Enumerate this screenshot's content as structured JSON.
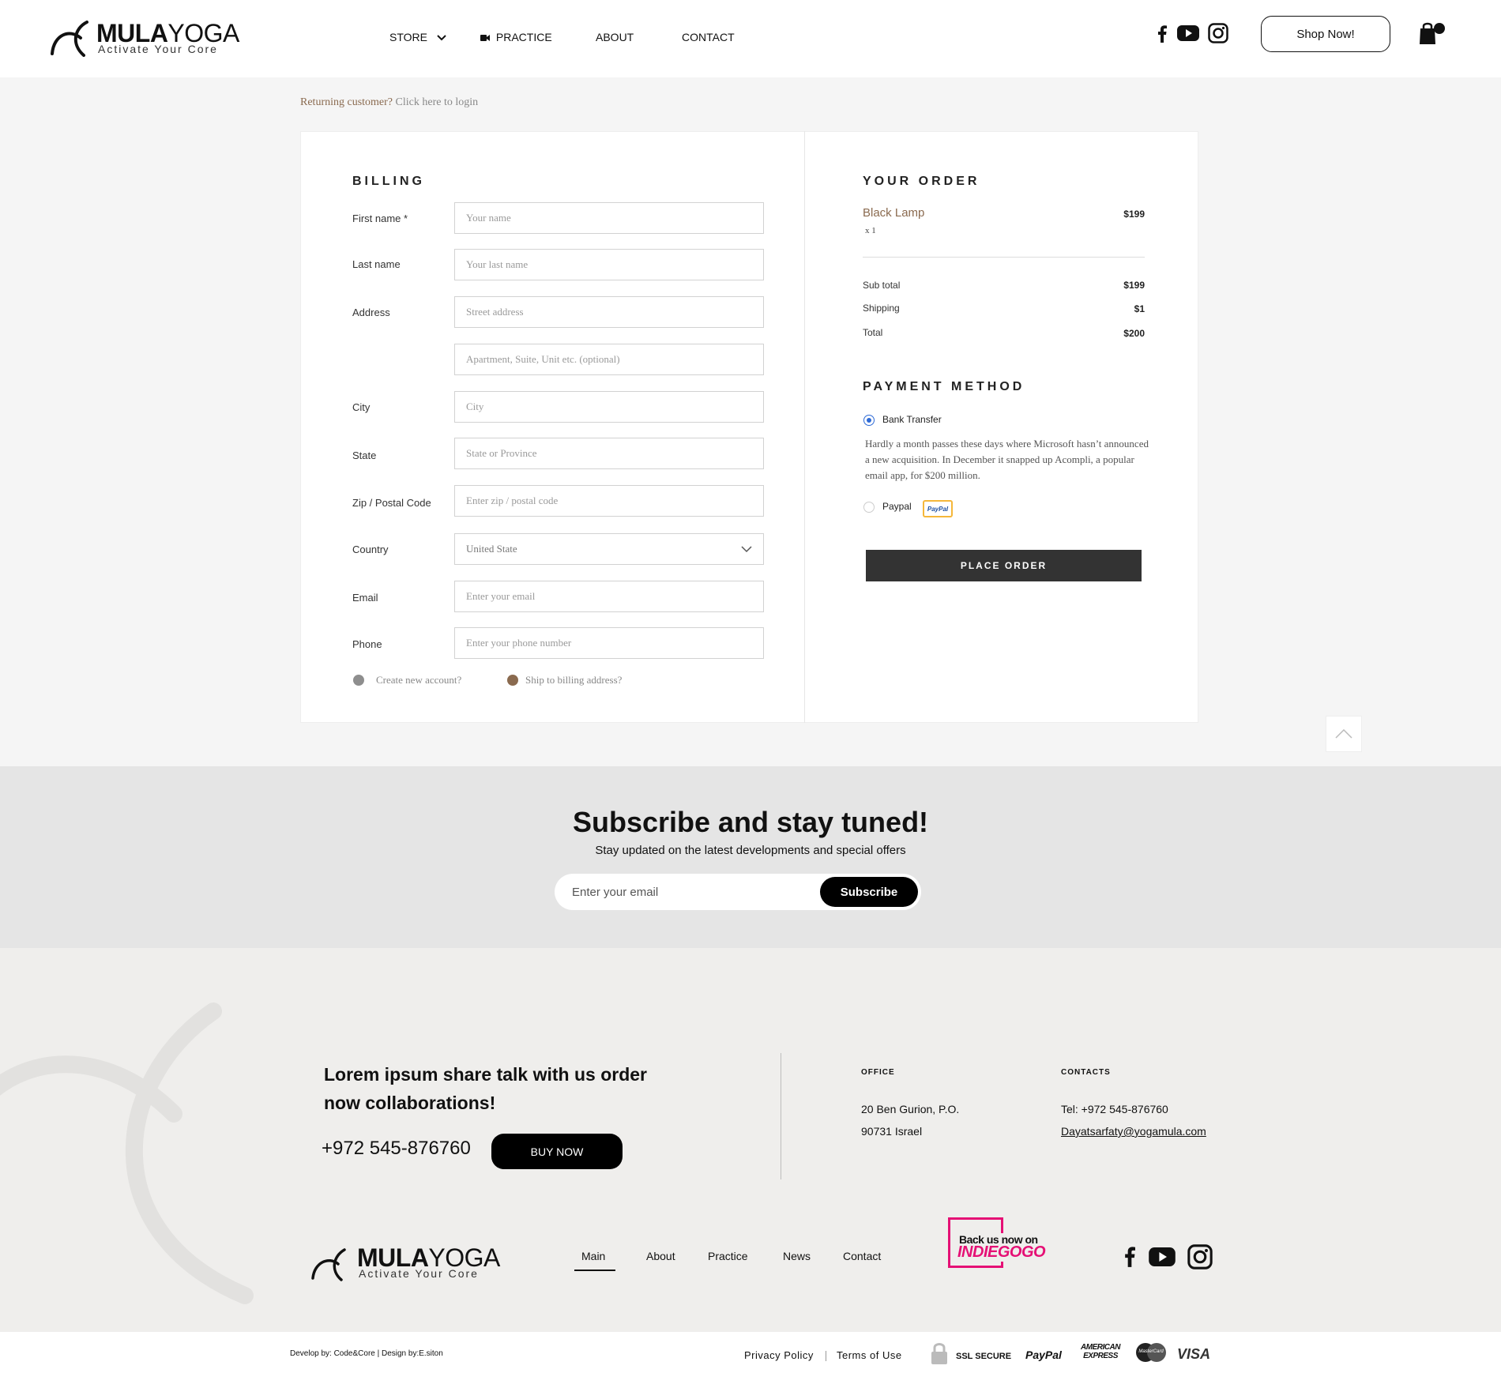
{
  "header": {
    "logo": {
      "brand_bold": "MULA",
      "brand_light": "YOGA",
      "tagline": "Activate Your Core"
    },
    "nav": [
      {
        "label": "STORE"
      },
      {
        "label": "PRACTICE"
      },
      {
        "label": "ABOUT"
      },
      {
        "label": "CONTACT"
      }
    ],
    "social_icons": [
      "facebook-icon",
      "youtube-icon",
      "instagram-icon"
    ],
    "shop_now_label": "Shop Now!",
    "cart_icon": "shopping-bag-icon"
  },
  "checkout": {
    "returning_question": "Returning customer?",
    "returning_link": "Click here to login",
    "billing": {
      "title": "BILLING",
      "fields": [
        {
          "label": "First name *",
          "placeholder": "Your name"
        },
        {
          "label": "Last name",
          "placeholder": "Your last name"
        },
        {
          "label": "Address",
          "placeholder": "Street address"
        },
        {
          "label": "",
          "placeholder": "Apartment, Suite, Unit etc. (optional)"
        },
        {
          "label": "City",
          "placeholder": "City"
        },
        {
          "label": "State",
          "placeholder": "State or Province"
        },
        {
          "label": "Zip / Postal Code",
          "placeholder": "Enter zip / postal code"
        },
        {
          "label": "Country",
          "value": "United State"
        },
        {
          "label": "Email",
          "placeholder": "Enter your email"
        },
        {
          "label": "Phone",
          "placeholder": "Enter your phone number"
        }
      ],
      "create_account_label": "Create new account?",
      "ship_billing_label": "Ship to billing address?"
    },
    "order": {
      "title": "YOUR ORDER",
      "item_name": "Black Lamp",
      "item_qty": "x 1",
      "item_price": "$199",
      "subtotal_label": "Sub total",
      "subtotal_value": "$199",
      "shipping_label": "Shipping",
      "shipping_value": "$1",
      "total_label": "Total",
      "total_value": "$200"
    },
    "payment": {
      "title": "PAYMENT METHOD",
      "bank_label": "Bank Transfer",
      "bank_description": "Hardly a month passes these days where Microsoft hasn’t announced a new acquisition. In December it snapped up Acompli, a popular email app, for $200 million.",
      "paypal_label": "Paypal",
      "paypal_badge": "PayPal",
      "place_order_label": "PLACE ORDER"
    }
  },
  "subscribe": {
    "title": "Subscribe and stay tuned!",
    "text": "Stay updated on the latest developments and special offers",
    "placeholder": "Enter your email",
    "button": "Subscribe"
  },
  "footer": {
    "pitch_line1": "Lorem ipsum share talk with us order",
    "pitch_line2": "now collaborations!",
    "phone": "+972 545-876760",
    "buy_now": "BUY NOW",
    "office_title": "OFFICE",
    "office_line1": "20 Ben Gurion, P.O.",
    "office_line2": "90731 Israel",
    "contacts_title": "CONTACTS",
    "contacts_tel": "Tel: +972 545-876760",
    "contacts_email": "Dayatsarfaty@yogamula.com",
    "logo": {
      "brand_bold": "MULA",
      "brand_light": "YOGA",
      "tagline": "Activate Your Core"
    },
    "nav": [
      "Main",
      "About",
      "Practice",
      "News",
      "Contact"
    ],
    "indiegogo_line1": "Back us now on",
    "indiegogo_line2": "INDIEGOGO",
    "social_icons": [
      "facebook-icon",
      "youtube-icon",
      "instagram-icon"
    ],
    "credits": "Develop by: Code&Core | Design by:E.siton",
    "privacy": "Privacy Policy",
    "terms": "Terms of Use",
    "ssl": "SSL SECURE",
    "paypal": "PayPal",
    "amex_line1": "AMERICAN",
    "amex_line2": "EXPRESS",
    "mastercard": "MasterCard",
    "visa": "VISA"
  },
  "colors": {
    "accent_brown": "#8a6a4f",
    "dark_button": "#333333",
    "indiegogo_pink": "#e51075",
    "radio_blue": "#2d6ad6"
  }
}
